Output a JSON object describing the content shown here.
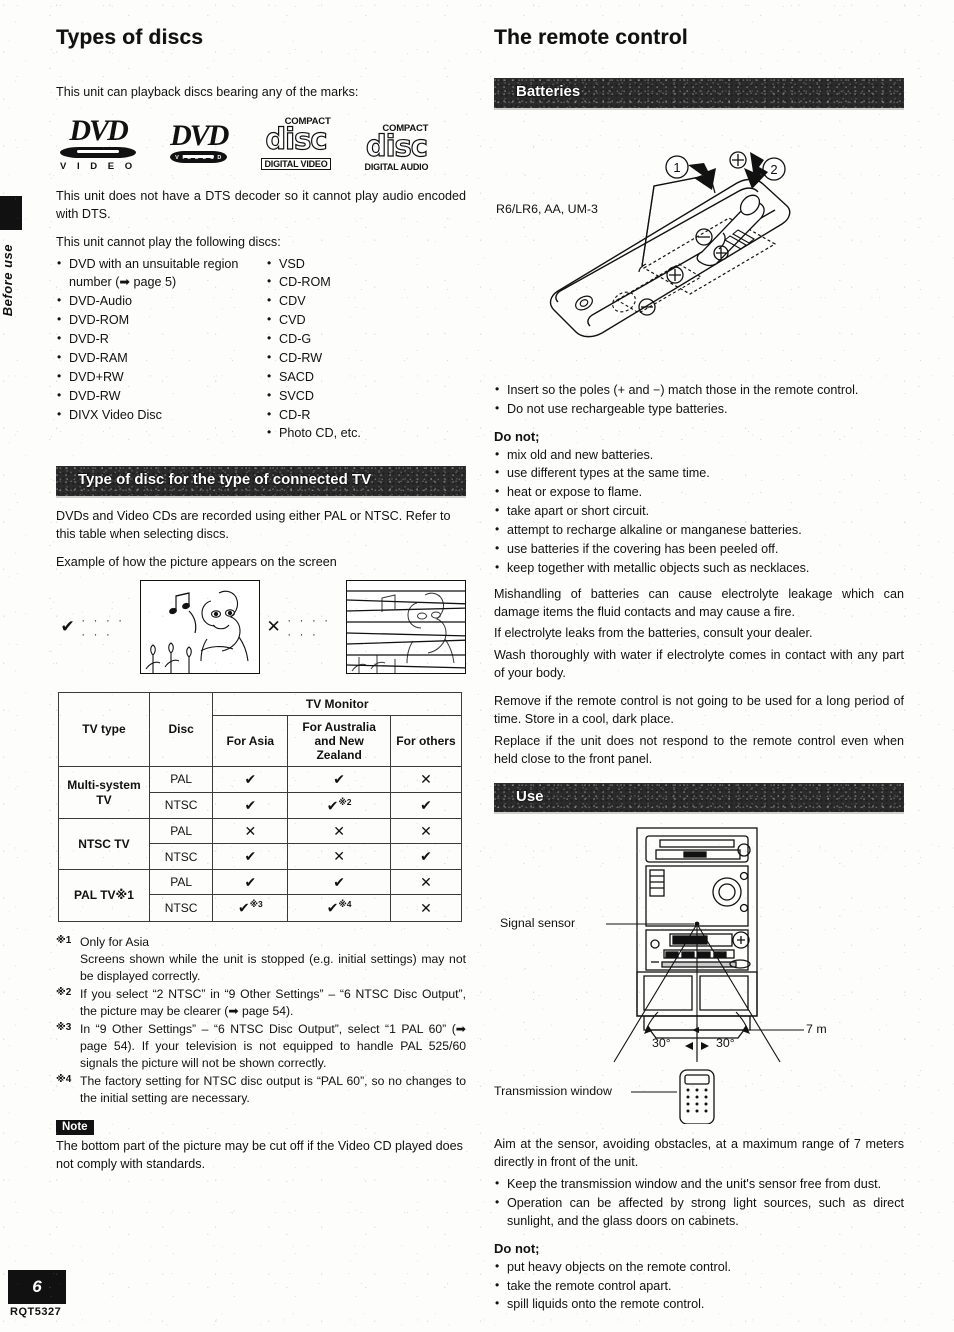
{
  "side_tab": {
    "label": "Before use"
  },
  "footer": {
    "page_number": "6",
    "doc_code": "RQT5327"
  },
  "left": {
    "title": "Types of discs",
    "intro": "This unit can playback discs bearing any of the marks:",
    "logos": [
      {
        "name": "dvd-video-logo",
        "mark": "DVD",
        "sub": "V I D E O",
        "bar_text": ""
      },
      {
        "name": "dvd-videocd-logo",
        "mark": "DVD",
        "sub": "",
        "bar_text": "V I D E O  C D"
      },
      {
        "name": "compact-disc-digital-video-logo",
        "top": "COMPACT",
        "disc": "disc",
        "bot": "DIGITAL VIDEO"
      },
      {
        "name": "compact-disc-digital-audio-logo",
        "top": "COMPACT",
        "disc": "disc",
        "bot": "DIGITAL AUDIO"
      }
    ],
    "dts_note": "This unit does not have a DTS decoder so it cannot play audio encoded with DTS.",
    "cannot_play_heading": "This unit cannot play the following discs:",
    "cannot_play_col1": [
      "DVD with an unsuitable region",
      "number (➡ page 5)",
      "DVD-Audio",
      "DVD-ROM",
      "DVD-R",
      "DVD-RAM",
      "DVD+RW",
      "DVD-RW",
      "DIVX Video Disc"
    ],
    "cannot_play_col2": [
      "VSD",
      "CD-ROM",
      "CDV",
      "CVD",
      "CD-G",
      "CD-RW",
      "SACD",
      "SVCD",
      "CD-R",
      "Photo CD, etc."
    ],
    "banner_tv": "Type of disc for the type of connected TV",
    "pal_ntsc_para": "DVDs and Video CDs are recorded using either PAL or NTSC. Refer to this table when selecting discs.",
    "example_caption": "Example of how the picture appears on the screen",
    "example_good_mark": "✔",
    "example_bad_mark": "✕",
    "example_dots": "· · · · · · ·",
    "footnotes": [
      {
        "marker": "※1",
        "text": "Only for Asia\nScreens shown while the unit is stopped (e.g. initial settings) may not be displayed correctly."
      },
      {
        "marker": "※2",
        "text": "If you select “2 NTSC” in “9 Other Settings” – “6 NTSC Disc Output”, the picture may be clearer (➡ page 54)."
      },
      {
        "marker": "※3",
        "text": "In “9 Other Settings” – “6 NTSC Disc Output”, select “1 PAL 60” (➡ page 54). If your television is not equipped to handle PAL 525/60 signals the picture will not be shown correctly."
      },
      {
        "marker": "※4",
        "text": "The factory setting for NTSC disc output is “PAL 60”, so no changes to the initial setting are necessary."
      }
    ],
    "note_label": "Note",
    "note_text": "The bottom part of the picture may be cut off if the Video CD played does not comply with standards."
  },
  "table": {
    "headers": {
      "tv_type": "TV type",
      "disc": "Disc",
      "monitor": "TV Monitor",
      "for_asia": "For Asia",
      "for_australia": "For Australia and New Zealand",
      "for_others": "For others"
    },
    "rows": [
      {
        "tv_type": "Multi-system TV",
        "discs": [
          {
            "disc": "PAL",
            "asia": "✔",
            "asia_fn": "",
            "anz": "✔",
            "anz_fn": "",
            "others": "✕",
            "others_fn": ""
          },
          {
            "disc": "NTSC",
            "asia": "✔",
            "asia_fn": "",
            "anz": "✔",
            "anz_fn": "※2",
            "others": "✔",
            "others_fn": ""
          }
        ]
      },
      {
        "tv_type": "NTSC TV",
        "discs": [
          {
            "disc": "PAL",
            "asia": "✕",
            "asia_fn": "",
            "anz": "✕",
            "anz_fn": "",
            "others": "✕",
            "others_fn": ""
          },
          {
            "disc": "NTSC",
            "asia": "✔",
            "asia_fn": "",
            "anz": "✕",
            "anz_fn": "",
            "others": "✔",
            "others_fn": ""
          }
        ]
      },
      {
        "tv_type": "PAL TV※1",
        "discs": [
          {
            "disc": "PAL",
            "asia": "✔",
            "asia_fn": "",
            "anz": "✔",
            "anz_fn": "",
            "others": "✕",
            "others_fn": ""
          },
          {
            "disc": "NTSC",
            "asia": "✔",
            "asia_fn": "※3",
            "anz": "✔",
            "anz_fn": "※4",
            "others": "✕",
            "others_fn": ""
          }
        ]
      }
    ]
  },
  "right": {
    "title": "The remote control",
    "banner_batteries": "Batteries",
    "battery_diagram": {
      "type_label": "R6/LR6, AA, UM-3",
      "step_1": "1",
      "step_2": "2",
      "plus": "⊕",
      "minus": "⊖"
    },
    "battery_bullets": [
      "Insert so the poles (+ and −) match those in the remote control.",
      "Do not use rechargeable type batteries."
    ],
    "do_not_label_1": "Do not;",
    "do_not_items": [
      "mix old and new batteries.",
      "use different types at the same time.",
      "heat or expose to flame.",
      "take apart or short circuit.",
      "attempt to recharge alkaline or manganese batteries.",
      "use batteries if the covering has been peeled off.",
      "keep together with metallic objects such as necklaces."
    ],
    "mishandling_para": "Mishandling of batteries can cause electrolyte leakage which can damage items the fluid contacts and may cause a fire.",
    "electrolyte_para": "If electrolyte leaks from the batteries, consult your dealer.",
    "wash_para": "Wash thoroughly with water if electrolyte comes in contact with any part of your body.",
    "remove_para": "Remove if the remote control is not going to be used for a long period of time. Store in a cool, dark place.",
    "replace_para": "Replace if the unit does not respond to the remote control even when held close to the front panel.",
    "banner_use": "Use",
    "use_diagram": {
      "signal_sensor": "Signal sensor",
      "transmission_window": "Transmission window",
      "distance": "7 m",
      "angle_left": "30°",
      "angle_right": "30°"
    },
    "aim_para": "Aim at the sensor, avoiding obstacles, at a maximum range of 7 meters directly in front of the unit.",
    "use_bullets": [
      "Keep the transmission window and the unit's sensor free from dust.",
      "Operation can be affected by strong light sources, such as direct sunlight, and the glass doors on cabinets."
    ],
    "do_not_label_2": "Do not;",
    "do_not_items_2": [
      "put heavy objects on the remote control.",
      "take the remote control apart.",
      "spill liquids onto the remote control."
    ]
  }
}
